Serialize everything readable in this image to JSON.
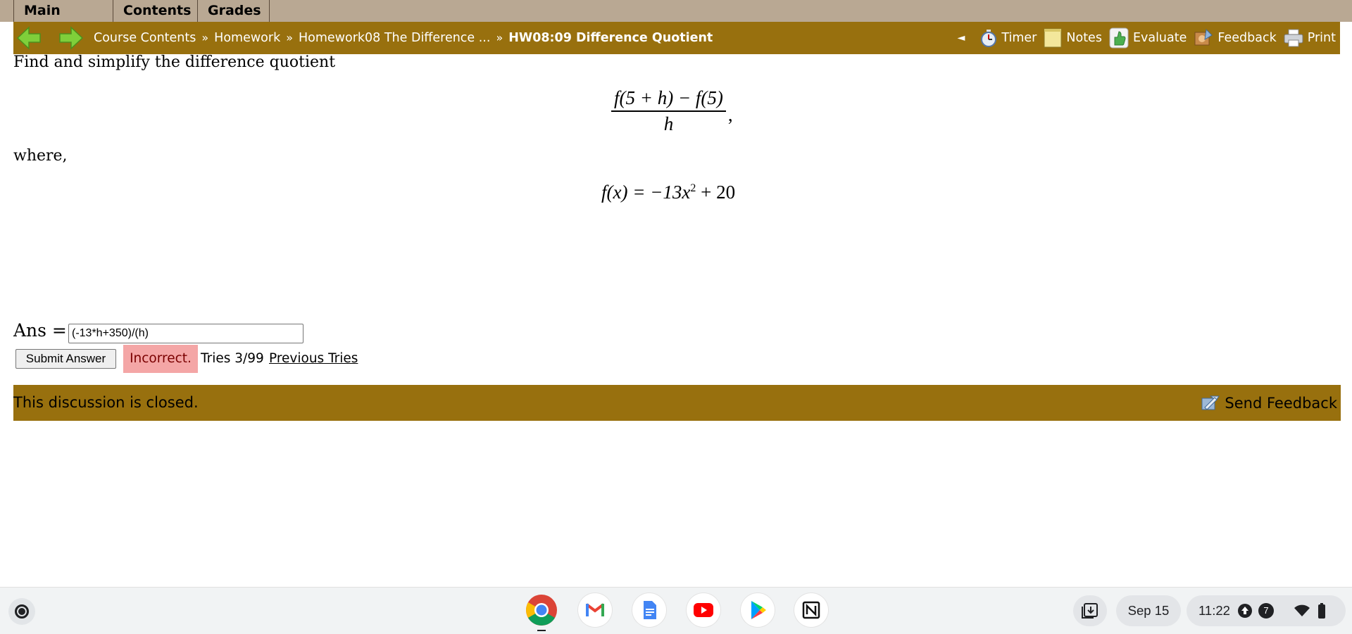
{
  "top_menu": {
    "main_menu": "Main Menu",
    "contents": "Contents",
    "grades": "Grades"
  },
  "breadcrumb": {
    "items": [
      "Course Contents",
      "Homework",
      "Homework08 The Difference ..."
    ],
    "separator": "»",
    "current": "HW08:09 Difference Quotient"
  },
  "toolbar": {
    "collapse": "◄",
    "timer": "Timer",
    "notes": "Notes",
    "evaluate": "Evaluate",
    "feedback": "Feedback",
    "print": "Print"
  },
  "problem": {
    "prompt": "Find and simplify the difference quotient",
    "fraction": {
      "numerator": "f(5 + h) − f(5)",
      "denominator": "h",
      "trailing": ","
    },
    "where": "where,",
    "function": {
      "lhs": "f(x) = −13x",
      "exponent": "2",
      "rhs": " + 20"
    }
  },
  "answer": {
    "label": "Ans =",
    "value": "(-13*h+350)/(h)",
    "submit_label": "Submit Answer",
    "status": "Incorrect.",
    "tries": "Tries 3/99",
    "previous_tries": "Previous Tries"
  },
  "discussion": {
    "status": "This discussion is closed.",
    "send_feedback": "Send Feedback"
  },
  "shelf": {
    "apps": [
      "chrome-icon",
      "gmail-icon",
      "docs-icon",
      "youtube-icon",
      "play-store-icon",
      "notion-icon"
    ],
    "date": "Sep 15",
    "time": "11:22",
    "notification_count": "7"
  },
  "colors": {
    "menu_bar": "#b9a893",
    "nav_bar": "#98700e",
    "incorrect_bg": "#f4a6a6",
    "shelf_bg": "#f1f3f4"
  }
}
